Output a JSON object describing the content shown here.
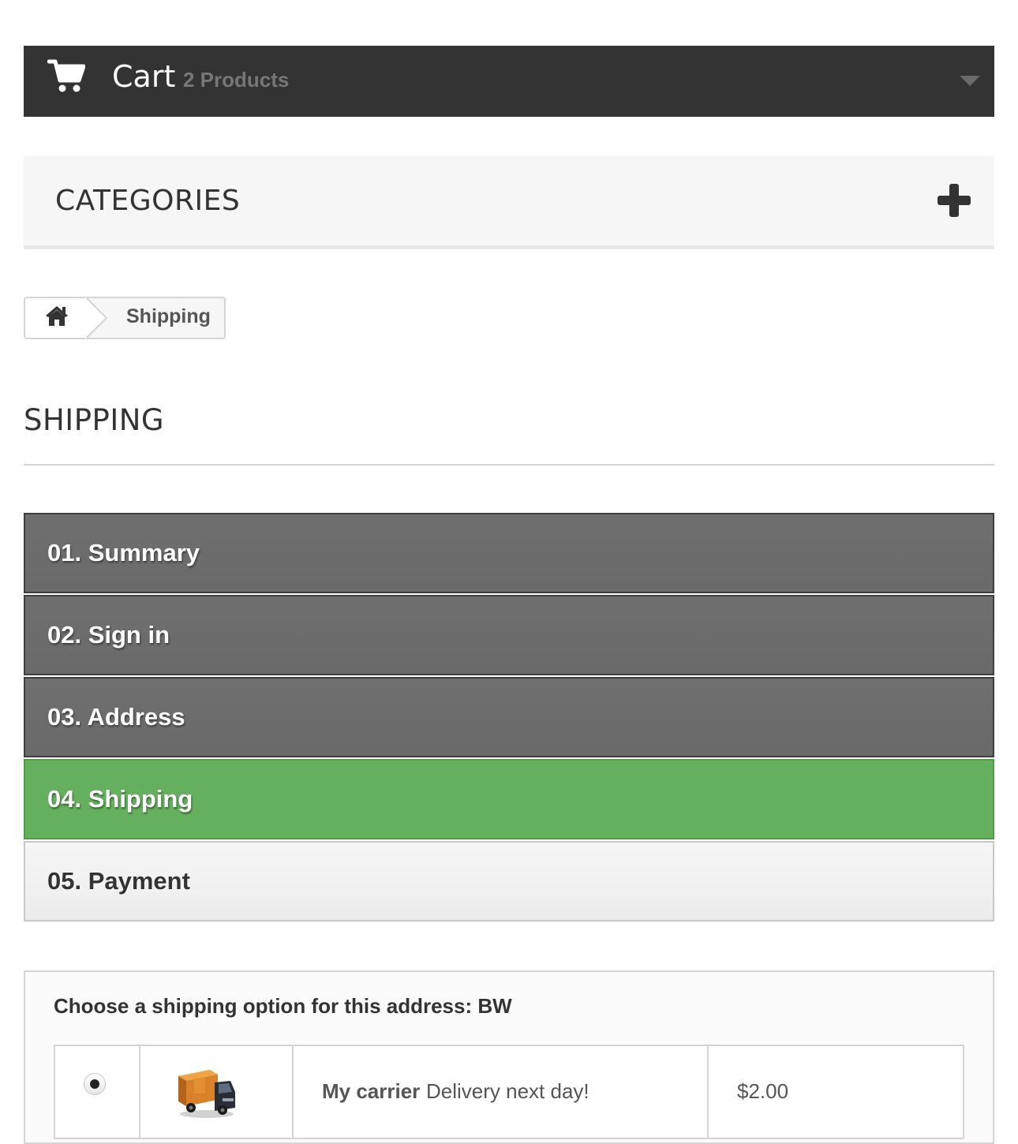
{
  "cart": {
    "icon": "cart-icon",
    "title": "Cart",
    "count": "2 Products",
    "toggle_icon": "chevron-down-icon"
  },
  "categories": {
    "title": "CATEGORIES",
    "toggle_icon": "plus-icon"
  },
  "breadcrumb": {
    "home_icon": "home-icon",
    "current": "Shipping"
  },
  "page": {
    "heading": "SHIPPING"
  },
  "steps": [
    {
      "label": "01. Summary",
      "state": "done"
    },
    {
      "label": "02. Sign in",
      "state": "done"
    },
    {
      "label": "03. Address",
      "state": "done"
    },
    {
      "label": "04. Shipping",
      "state": "current"
    },
    {
      "label": "05. Payment",
      "state": "todo"
    }
  ],
  "colors": {
    "cart_bar": "#333333",
    "step_done": "#6c6c6c",
    "step_current": "#64b05e",
    "step_todo": "#f3f3f3"
  },
  "shipping": {
    "title": "Choose a shipping option for this address: BW",
    "options": [
      {
        "selected": true,
        "carrier_icon": "truck-icon",
        "carrier_name": "My carrier",
        "delay": "Delivery next day!",
        "price": "$2.00"
      }
    ]
  }
}
